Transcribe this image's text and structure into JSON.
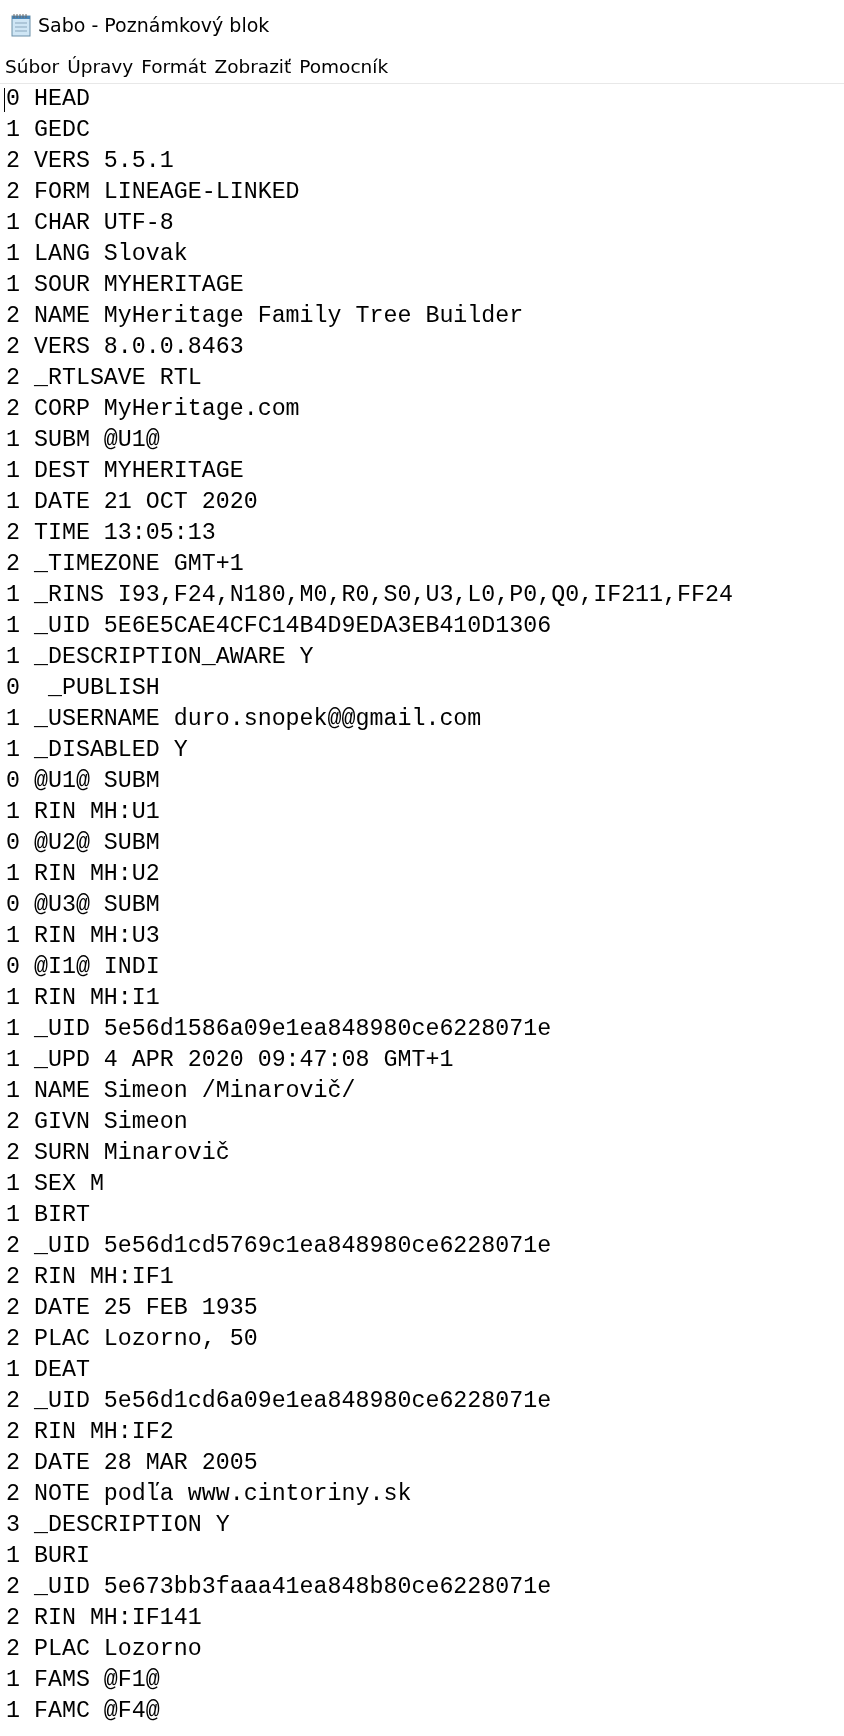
{
  "window": {
    "title": "Sabo - Poznámkový blok"
  },
  "menu": [
    "Súbor",
    "Úpravy",
    "Formát",
    "Zobraziť",
    "Pomocník"
  ],
  "lines": [
    "0 HEAD",
    "1 GEDC",
    "2 VERS 5.5.1",
    "2 FORM LINEAGE-LINKED",
    "1 CHAR UTF-8",
    "1 LANG Slovak",
    "1 SOUR MYHERITAGE",
    "2 NAME MyHeritage Family Tree Builder",
    "2 VERS 8.0.0.8463",
    "2 _RTLSAVE RTL",
    "2 CORP MyHeritage.com",
    "1 SUBM @U1@",
    "1 DEST MYHERITAGE",
    "1 DATE 21 OCT 2020",
    "2 TIME 13:05:13",
    "2 _TIMEZONE GMT+1",
    "1 _RINS I93,F24,N180,M0,R0,S0,U3,L0,P0,Q0,IF211,FF24",
    "1 _UID 5E6E5CAE4CFC14B4D9EDA3EB410D1306",
    "1 _DESCRIPTION_AWARE Y",
    "0  _PUBLISH",
    "1 _USERNAME duro.snopek@@gmail.com",
    "1 _DISABLED Y",
    "0 @U1@ SUBM",
    "1 RIN MH:U1",
    "0 @U2@ SUBM",
    "1 RIN MH:U2",
    "0 @U3@ SUBM",
    "1 RIN MH:U3",
    "0 @I1@ INDI",
    "1 RIN MH:I1",
    "1 _UID 5e56d1586a09e1ea848980ce6228071e",
    "1 _UPD 4 APR 2020 09:47:08 GMT+1",
    "1 NAME Simeon /Minarovič/",
    "2 GIVN Simeon",
    "2 SURN Minarovič",
    "1 SEX M",
    "1 BIRT",
    "2 _UID 5e56d1cd5769c1ea848980ce6228071e",
    "2 RIN MH:IF1",
    "2 DATE 25 FEB 1935",
    "2 PLAC Lozorno, 50",
    "1 DEAT",
    "2 _UID 5e56d1cd6a09e1ea848980ce6228071e",
    "2 RIN MH:IF2",
    "2 DATE 28 MAR 2005",
    "2 NOTE podľa www.cintoriny.sk",
    "3 _DESCRIPTION Y",
    "1 BURI",
    "2 _UID 5e673bb3faaa41ea848b80ce6228071e",
    "2 RIN MH:IF141",
    "2 PLAC Lozorno",
    "1 FAMS @F1@",
    "1 FAMC @F4@"
  ]
}
